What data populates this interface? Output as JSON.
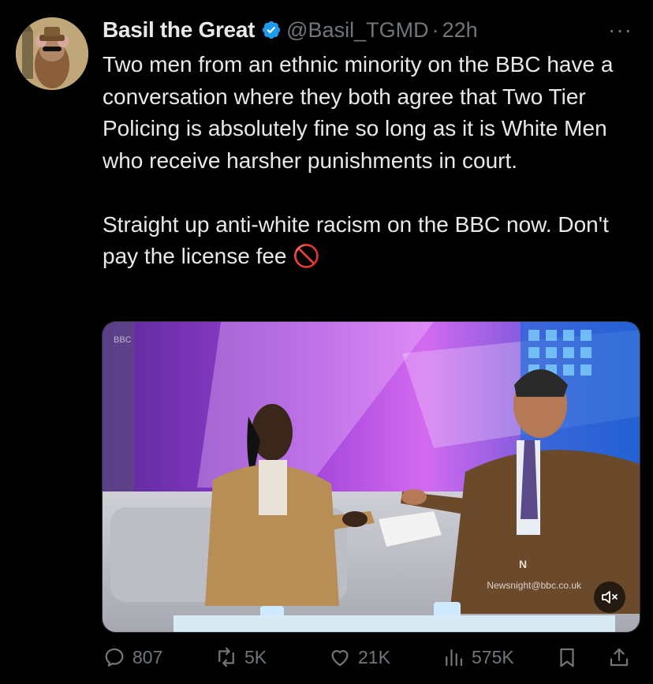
{
  "author": {
    "name": "Basil the Great",
    "handle": "@Basil_TGMD",
    "separator": "·",
    "time": "22h",
    "verified_color": "#1d9bf0"
  },
  "more_label": "···",
  "tweet": {
    "text": "Two men from an ethnic minority on the BBC have a conversation where they both agree that Two Tier Policing is absolutely fine so long as it is White Men who receive harsher punishments in court.\n\nStraight up anti-white racism on the BBC now. Don't pay the license fee 🚫"
  },
  "media": {
    "type": "video",
    "watermark": "Newsnight@bbc.co.uk",
    "muted": true
  },
  "actions": {
    "replies": "807",
    "reposts": "5K",
    "likes": "21K",
    "views": "575K"
  },
  "colors": {
    "background": "#000000",
    "text": "#e7e9ea",
    "muted": "#71767b",
    "accent": "#1d9bf0"
  }
}
